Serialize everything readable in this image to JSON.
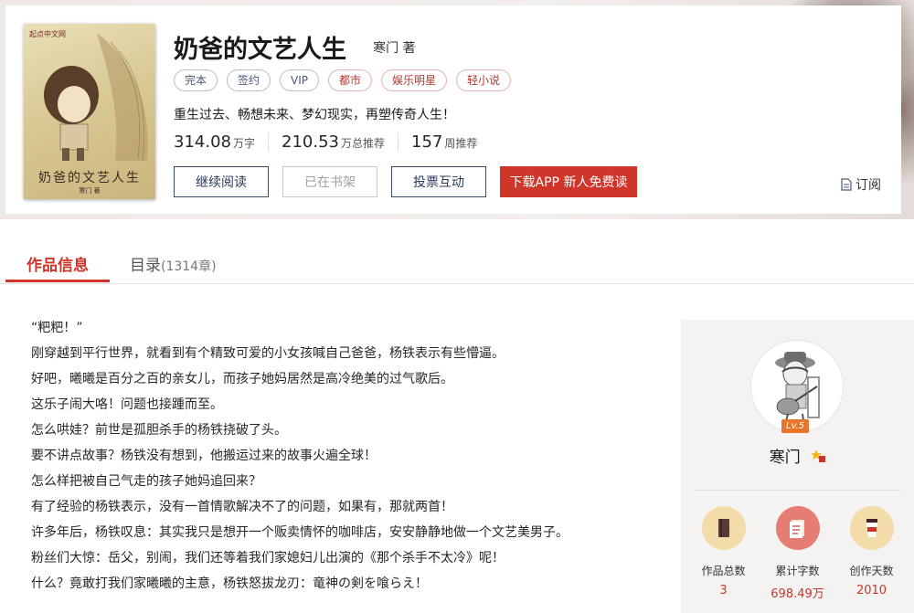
{
  "book": {
    "cover_logo": "起点中文网",
    "cover_title": "奶爸的文艺人生",
    "cover_author": "寒门 著",
    "title": "奶爸的文艺人生",
    "author_line": "寒门 著",
    "tags": [
      "完本",
      "签约",
      "VIP",
      "都市",
      "娱乐明星",
      "轻小说"
    ],
    "tag_styles": [
      "blue",
      "blue",
      "blue",
      "red",
      "red",
      "red"
    ],
    "intro": "重生过去、畅想未来、梦幻现实，再塑传奇人生！",
    "stats": [
      {
        "value": "314.08",
        "unit": "万字"
      },
      {
        "value": "210.53",
        "unit": "万总推荐"
      },
      {
        "value": "157",
        "unit": "周推荐"
      }
    ],
    "buttons": {
      "continue_read": "继续阅读",
      "on_shelf": "已在书架",
      "vote": "投票互动",
      "download_app": "下载APP 新人免费读"
    },
    "subscribe": "订阅"
  },
  "tabs": {
    "info": "作品信息",
    "catalog": "目录",
    "catalog_count": "(1314章)"
  },
  "synopsis": [
    "“粑粑！”",
    "刚穿越到平行世界，就看到有个精致可爱的小女孩喊自己爸爸，杨铁表示有些懵逼。",
    "好吧，曦曦是百分之百的亲女儿，而孩子她妈居然是高冷绝美的过气歌后。",
    "这乐子闹大咯！问题也接踵而至。",
    "怎么哄娃？前世是孤胆杀手的杨铁挠破了头。",
    "要不讲点故事？杨铁没有想到，他搬运过来的故事火遍全球！",
    "怎么样把被自己气走的孩子她妈追回来？",
    "有了经验的杨铁表示，没有一首情歌解决不了的问题，如果有，那就两首！",
    "许多年后，杨铁叹息：其实我只是想开一个贩卖情怀的咖啡店，安安静静地做一个文艺美男子。",
    "粉丝们大惊：岳父，别闹，我们还等着我们家媳妇儿出演的《那个杀手不太冷》呢！",
    "什么？竟敢打我们家曦曦的主意，杨铁怒拔龙刃：竜神の剣を喰らえ！"
  ],
  "author": {
    "level": "Lv.5",
    "name": "寒门",
    "metrics": [
      {
        "label": "作品总数",
        "value": "3"
      },
      {
        "label": "累计字数",
        "value": "698.49万"
      },
      {
        "label": "创作天数",
        "value": "2010"
      }
    ]
  },
  "colors": {
    "accent_red": "#d0352a",
    "tag_blue": "#4a5a7a",
    "panel_bg": "#f5f3f2"
  }
}
